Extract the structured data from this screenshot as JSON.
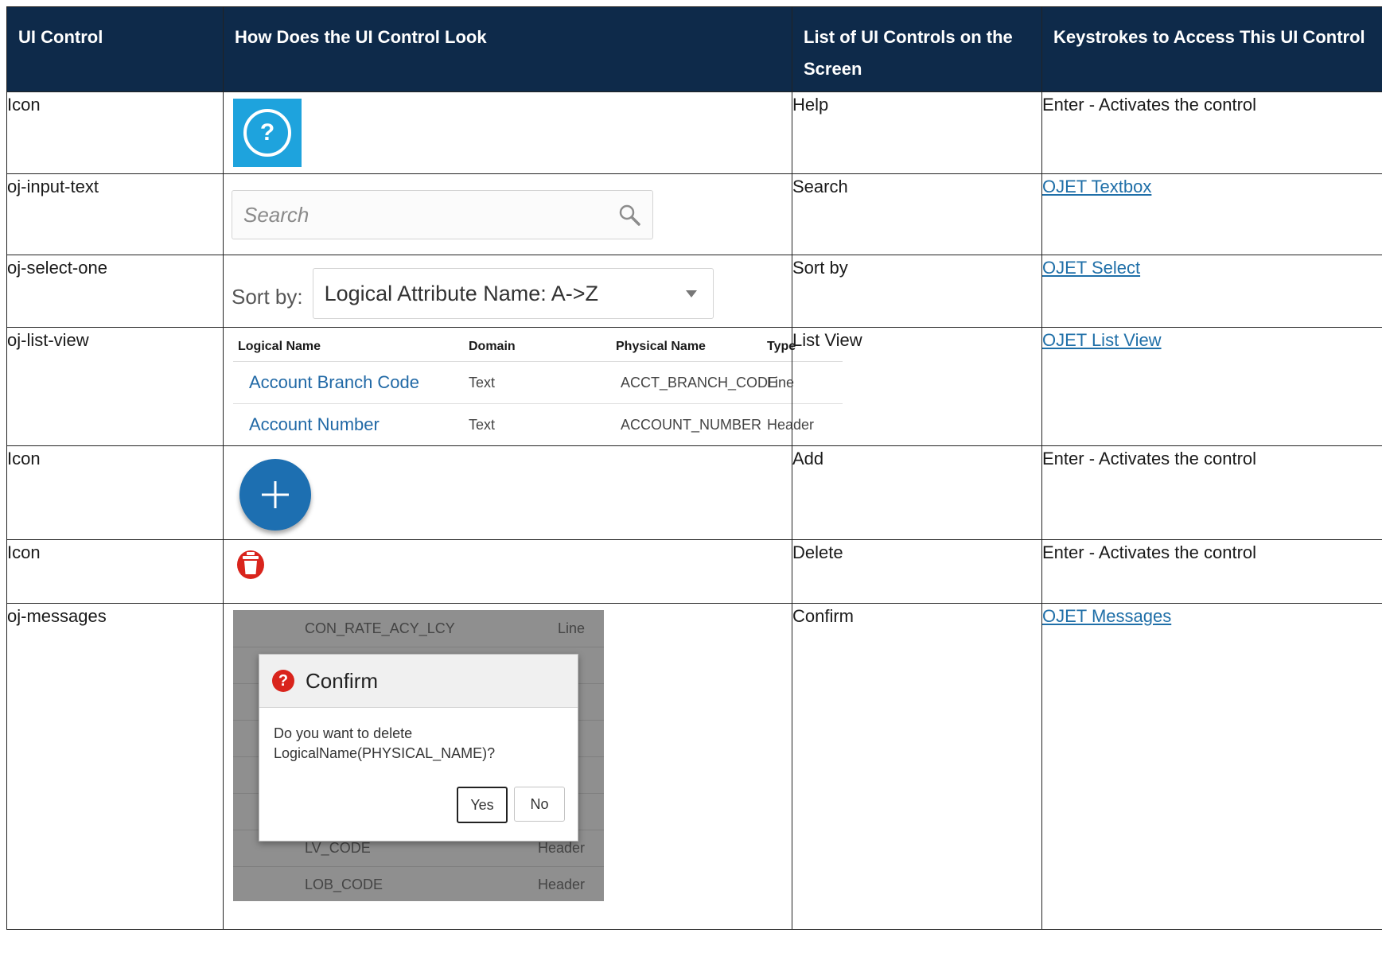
{
  "table": {
    "headers": [
      "UI Control",
      "How Does the UI Control Look",
      "List of UI Controls on the Screen",
      "Keystrokes to Access This UI Control"
    ],
    "rows": [
      {
        "control": "Icon",
        "name": "Help",
        "keys": "Enter - Activates the control"
      },
      {
        "control": "oj-input-text",
        "name": "Search",
        "keys": "OJET Textbox"
      },
      {
        "control": "oj-select-one",
        "name": "Sort by",
        "keys": "OJET Select"
      },
      {
        "control": "oj-list-view",
        "name": "List View",
        "keys": "OJET List View"
      },
      {
        "control": "Icon",
        "name": "Add",
        "keys": "Enter - Activates the control"
      },
      {
        "control": "Icon",
        "name": "Delete",
        "keys": "Enter - Activates the control"
      },
      {
        "control": "oj-messages",
        "name": "Confirm",
        "keys": "OJET Messages"
      }
    ]
  },
  "search": {
    "placeholder": "Search"
  },
  "sort": {
    "label": "Sort by:",
    "value": "Logical Attribute Name: A->Z"
  },
  "list_view": {
    "headers": [
      "Logical Name",
      "Domain",
      "Physical Name",
      "Type"
    ],
    "rows": [
      [
        "Account Branch Code",
        "Text",
        "ACCT_BRANCH_CODE",
        "Line"
      ],
      [
        "Account Number",
        "Text",
        "ACCOUNT_NUMBER",
        "Header"
      ]
    ]
  },
  "messages": {
    "background_rows": [
      {
        "code": "CON_RATE_ACY_LCY",
        "type": "Line"
      },
      {
        "code": "LV_CODE",
        "type": "Header"
      },
      {
        "code": "LOB_CODE",
        "type": "Header"
      }
    ],
    "title": "Confirm",
    "body_line1": "Do you want to delete",
    "body_line2": "LogicalName(PHYSICAL_NAME)?",
    "yes": "Yes",
    "no": "No"
  },
  "colors": {
    "header_bg": "#0e2a4a",
    "link": "#1f6fa8",
    "help_bg": "#1ea3dd",
    "add_bg": "#1d6fb1",
    "delete_red": "#d9241c"
  },
  "icons": [
    "help-icon",
    "search-icon",
    "chevron-down-icon",
    "plus-icon",
    "trash-icon",
    "question-icon"
  ]
}
